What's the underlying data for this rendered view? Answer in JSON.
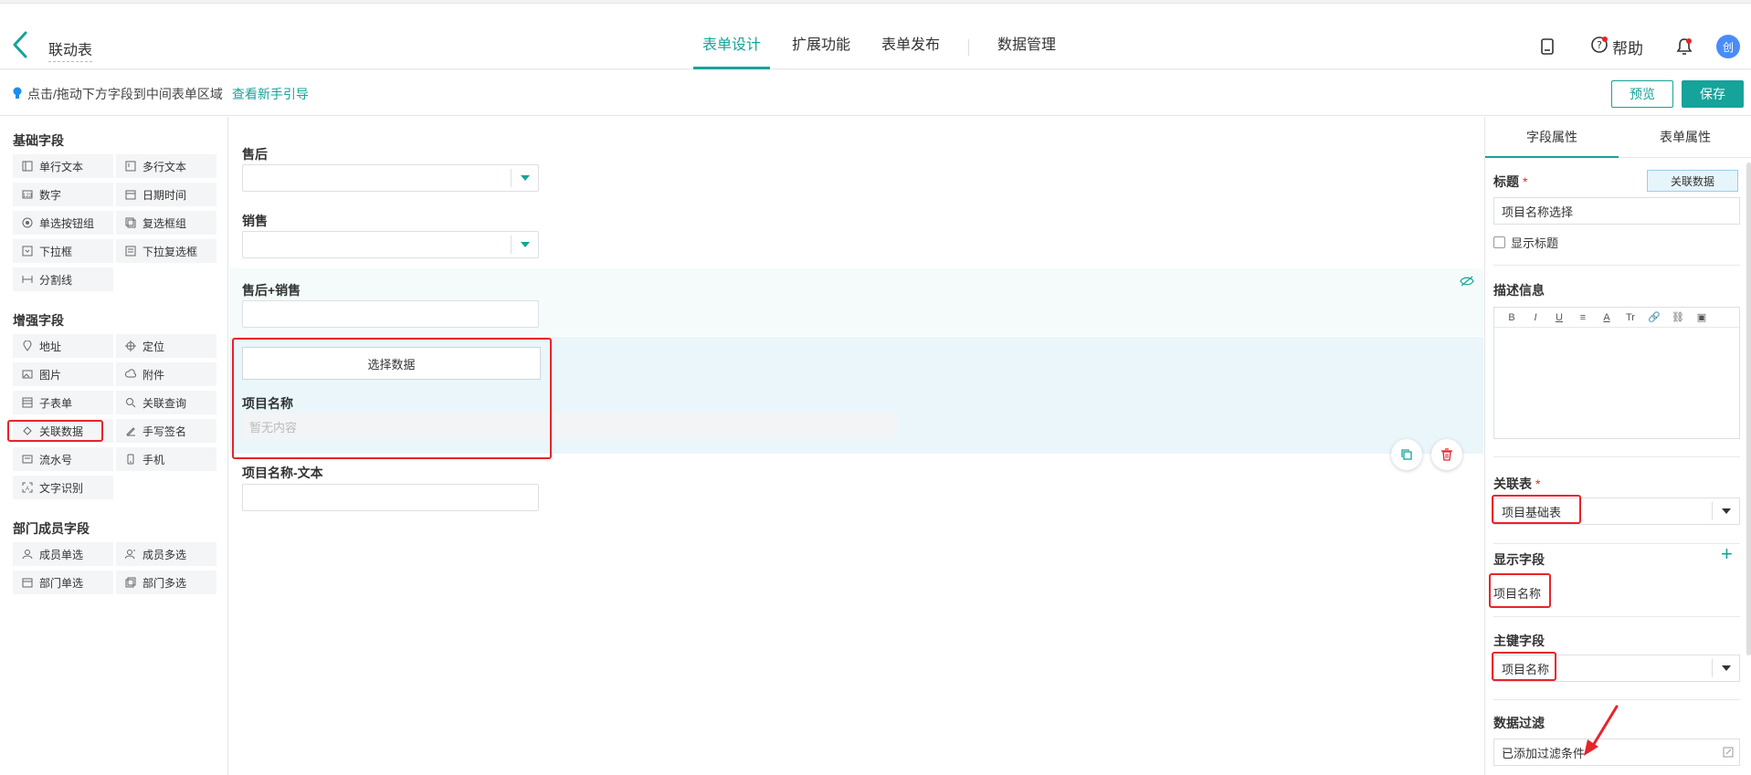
{
  "header": {
    "form_name": "联动表",
    "tabs": [
      {
        "label": "表单设计"
      },
      {
        "label": "扩展功能"
      },
      {
        "label": "表单发布"
      },
      {
        "label": "数据管理"
      }
    ],
    "help_label": "帮助",
    "avatar_text": "创",
    "accent_color": "#16a39a"
  },
  "hintbar": {
    "hint": "点击/拖动下方字段到中间表单区域",
    "guide_link": "查看新手引导",
    "preview_label": "预览",
    "save_label": "保存"
  },
  "left": {
    "groups": [
      {
        "title": "基础字段",
        "items": [
          {
            "label": "单行文本",
            "icon": "single-line-icon"
          },
          {
            "label": "多行文本",
            "icon": "multi-line-icon"
          },
          {
            "label": "数字",
            "icon": "number-icon"
          },
          {
            "label": "日期时间",
            "icon": "calendar-icon"
          },
          {
            "label": "单选按钮组",
            "icon": "radio-icon"
          },
          {
            "label": "复选框组",
            "icon": "checkbox-group-icon"
          },
          {
            "label": "下拉框",
            "icon": "dropdown-icon"
          },
          {
            "label": "下拉复选框",
            "icon": "dropdown-multi-icon"
          },
          {
            "label": "分割线",
            "icon": "divider-icon"
          }
        ]
      },
      {
        "title": "增强字段",
        "items": [
          {
            "label": "地址",
            "icon": "location-pin-icon"
          },
          {
            "label": "定位",
            "icon": "crosshair-icon"
          },
          {
            "label": "图片",
            "icon": "image-icon"
          },
          {
            "label": "附件",
            "icon": "cloud-upload-icon"
          },
          {
            "label": "子表单",
            "icon": "subform-icon"
          },
          {
            "label": "关联查询",
            "icon": "link-query-icon"
          },
          {
            "label": "关联数据",
            "icon": "link-data-icon"
          },
          {
            "label": "手写签名",
            "icon": "pen-icon"
          },
          {
            "label": "流水号",
            "icon": "serial-icon"
          },
          {
            "label": "手机",
            "icon": "mobile-icon"
          },
          {
            "label": "文字识别",
            "icon": "ocr-icon"
          }
        ]
      },
      {
        "title": "部门成员字段",
        "items": [
          {
            "label": "成员单选",
            "icon": "member-icon"
          },
          {
            "label": "成员多选",
            "icon": "members-icon"
          },
          {
            "label": "部门单选",
            "icon": "department-icon"
          },
          {
            "label": "部门多选",
            "icon": "departments-icon"
          }
        ]
      }
    ]
  },
  "canvas": {
    "field1_label": "售后",
    "field2_label": "销售",
    "field3_label": "售后+销售",
    "select_data_label": "选择数据",
    "field4_label": "项目名称",
    "field4_placeholder": "暂无内容",
    "field5_label": "项目名称-文本"
  },
  "right": {
    "tabs": [
      {
        "label": "字段属性"
      },
      {
        "label": "表单属性"
      }
    ],
    "title_label": "标题",
    "required_mark": "*",
    "link_data_tag": "关联数据",
    "title_value": "项目名称选择",
    "show_title_label": "显示标题",
    "desc_label": "描述信息",
    "toolbar": [
      "B",
      "I",
      "U",
      "≡",
      "A",
      "Tr",
      "🔗",
      "⛓",
      "▣"
    ],
    "link_table_label": "关联表",
    "link_table_value": "项目基础表",
    "display_field_label": "显示字段",
    "display_field_value": "项目名称",
    "key_field_label": "主键字段",
    "key_field_value": "项目名称",
    "filter_label": "数据过滤",
    "filter_value": "已添加过滤条件"
  }
}
